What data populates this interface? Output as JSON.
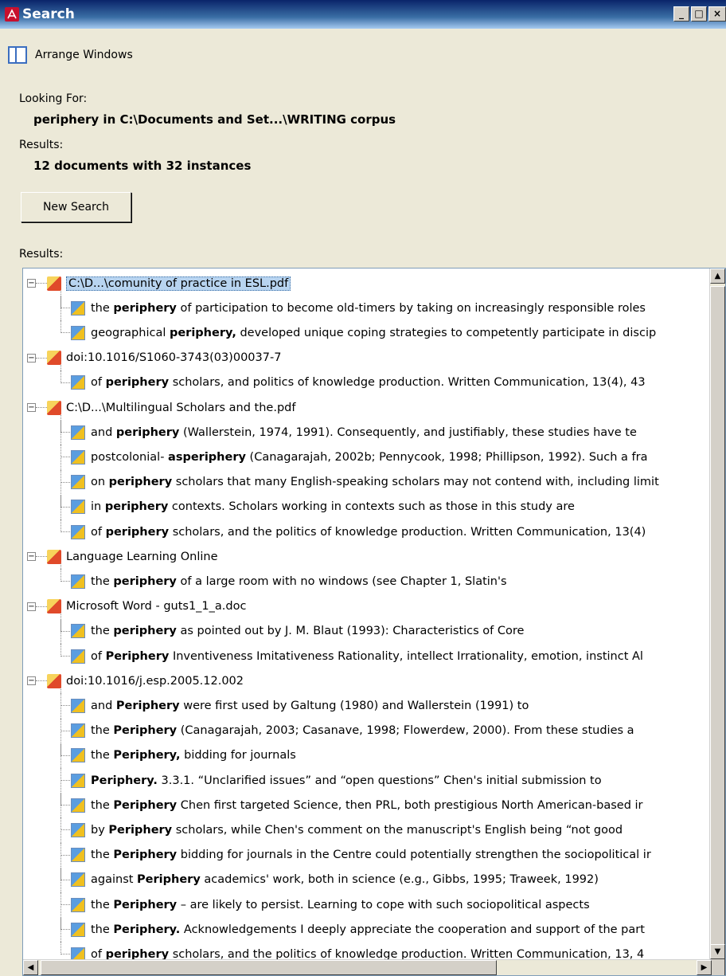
{
  "window": {
    "title": "Search",
    "min_label": "_",
    "max_label": "□",
    "close_label": "×"
  },
  "arrange_label": "Arrange Windows",
  "looking_for_label": "Looking For:",
  "looking_for_value": "periphery in C:\\Documents and Set...\\WRITING corpus",
  "results_label": "Results:",
  "results_value": "12 documents with 32 instances",
  "new_search_label": "New Search",
  "results_list_label": "Results:",
  "tree": [
    {
      "type": "doc",
      "label": "C:\\D...\\comunity of practice in ESL.pdf",
      "selected": true
    },
    {
      "type": "hit",
      "pre": "the",
      "kw": "periphery",
      "post": "of participation to become old-timers by taking on increasingly responsible roles"
    },
    {
      "type": "hit",
      "pre": "geographical",
      "kw": "periphery,",
      "post": "developed unique coping strategies to competently participate in discip"
    },
    {
      "type": "doc",
      "label": "doi:10.1016/S1060-3743(03)00037-7"
    },
    {
      "type": "hit",
      "pre": "of",
      "kw": "periphery",
      "post": "scholars, and politics of knowledge production. Written Communication, 13(4), 43"
    },
    {
      "type": "doc",
      "label": "C:\\D...\\Multilingual Scholars and the.pdf"
    },
    {
      "type": "hit",
      "pre": "and",
      "kw": "periphery",
      "post": "(Wallerstein, 1974, 1991). Consequently, and justifiably, these studies have te"
    },
    {
      "type": "hit",
      "pre": "postcolonial-",
      "kw": "asperiphery",
      "post": "(Canagarajah, 2002b; Pennycook, 1998; Phillipson, 1992). Such a fra"
    },
    {
      "type": "hit",
      "pre": "on",
      "kw": "periphery",
      "post": "scholars that many English-speaking scholars may not contend with, including limit"
    },
    {
      "type": "hit",
      "pre": "in",
      "kw": "periphery",
      "post": "contexts. Scholars working in contexts such as those in this study are"
    },
    {
      "type": "hit",
      "pre": "of",
      "kw": "periphery",
      "post": "scholars, and the politics of knowledge production. Written Communication, 13(4)"
    },
    {
      "type": "doc",
      "label": "Language Learning Online"
    },
    {
      "type": "hit",
      "pre": "the",
      "kw": "periphery",
      "post": "of a large room with no windows (see Chapter 1, Slatin's"
    },
    {
      "type": "doc",
      "label": "Microsoft Word - guts1_1_a.doc"
    },
    {
      "type": "hit",
      "pre": "the",
      "kw": "periphery",
      "post": "as pointed out by J. M. Blaut (1993): Characteristics of Core"
    },
    {
      "type": "hit",
      "pre": "of",
      "kw": "Periphery",
      "post": "Inventiveness Imitativeness Rationality, intellect Irrationality, emotion, instinct Al"
    },
    {
      "type": "doc",
      "label": "doi:10.1016/j.esp.2005.12.002"
    },
    {
      "type": "hit",
      "pre": "and",
      "kw": "Periphery",
      "post": "were first used by Galtung (1980) and Wallerstein (1991) to"
    },
    {
      "type": "hit",
      "pre": "the",
      "kw": "Periphery",
      "post": "(Canagarajah, 2003; Casanave, 1998; Flowerdew, 2000). From these studies a"
    },
    {
      "type": "hit",
      "pre": "the",
      "kw": "Periphery,",
      "post": "bidding for journals"
    },
    {
      "type": "hit",
      "pre": "",
      "kw": "Periphery.",
      "post": "3.3.1. “Unclarified issues” and “open questions” Chen's initial submission to"
    },
    {
      "type": "hit",
      "pre": "the",
      "kw": "Periphery",
      "post": "Chen first targeted Science, then PRL, both prestigious North American-based ir"
    },
    {
      "type": "hit",
      "pre": "by",
      "kw": "Periphery",
      "post": "scholars, while Chen's comment on the manuscript's English being “not good"
    },
    {
      "type": "hit",
      "pre": "the",
      "kw": "Periphery",
      "post": "bidding for journals in the Centre could potentially strengthen the sociopolitical ir"
    },
    {
      "type": "hit",
      "pre": "against",
      "kw": "Periphery",
      "post": "academics' work, both in science (e.g., Gibbs, 1995; Traweek, 1992)"
    },
    {
      "type": "hit",
      "pre": "the",
      "kw": "Periphery",
      "post": "– are likely to persist. Learning to cope with such sociopolitical aspects"
    },
    {
      "type": "hit",
      "pre": "the",
      "kw": "Periphery.",
      "post": "Acknowledgements I deeply appreciate the cooperation and support of the part"
    },
    {
      "type": "hit",
      "pre": "of",
      "kw": "periphery",
      "post": "scholars, and the politics of knowledge production. Written Communication, 13, 4"
    }
  ]
}
